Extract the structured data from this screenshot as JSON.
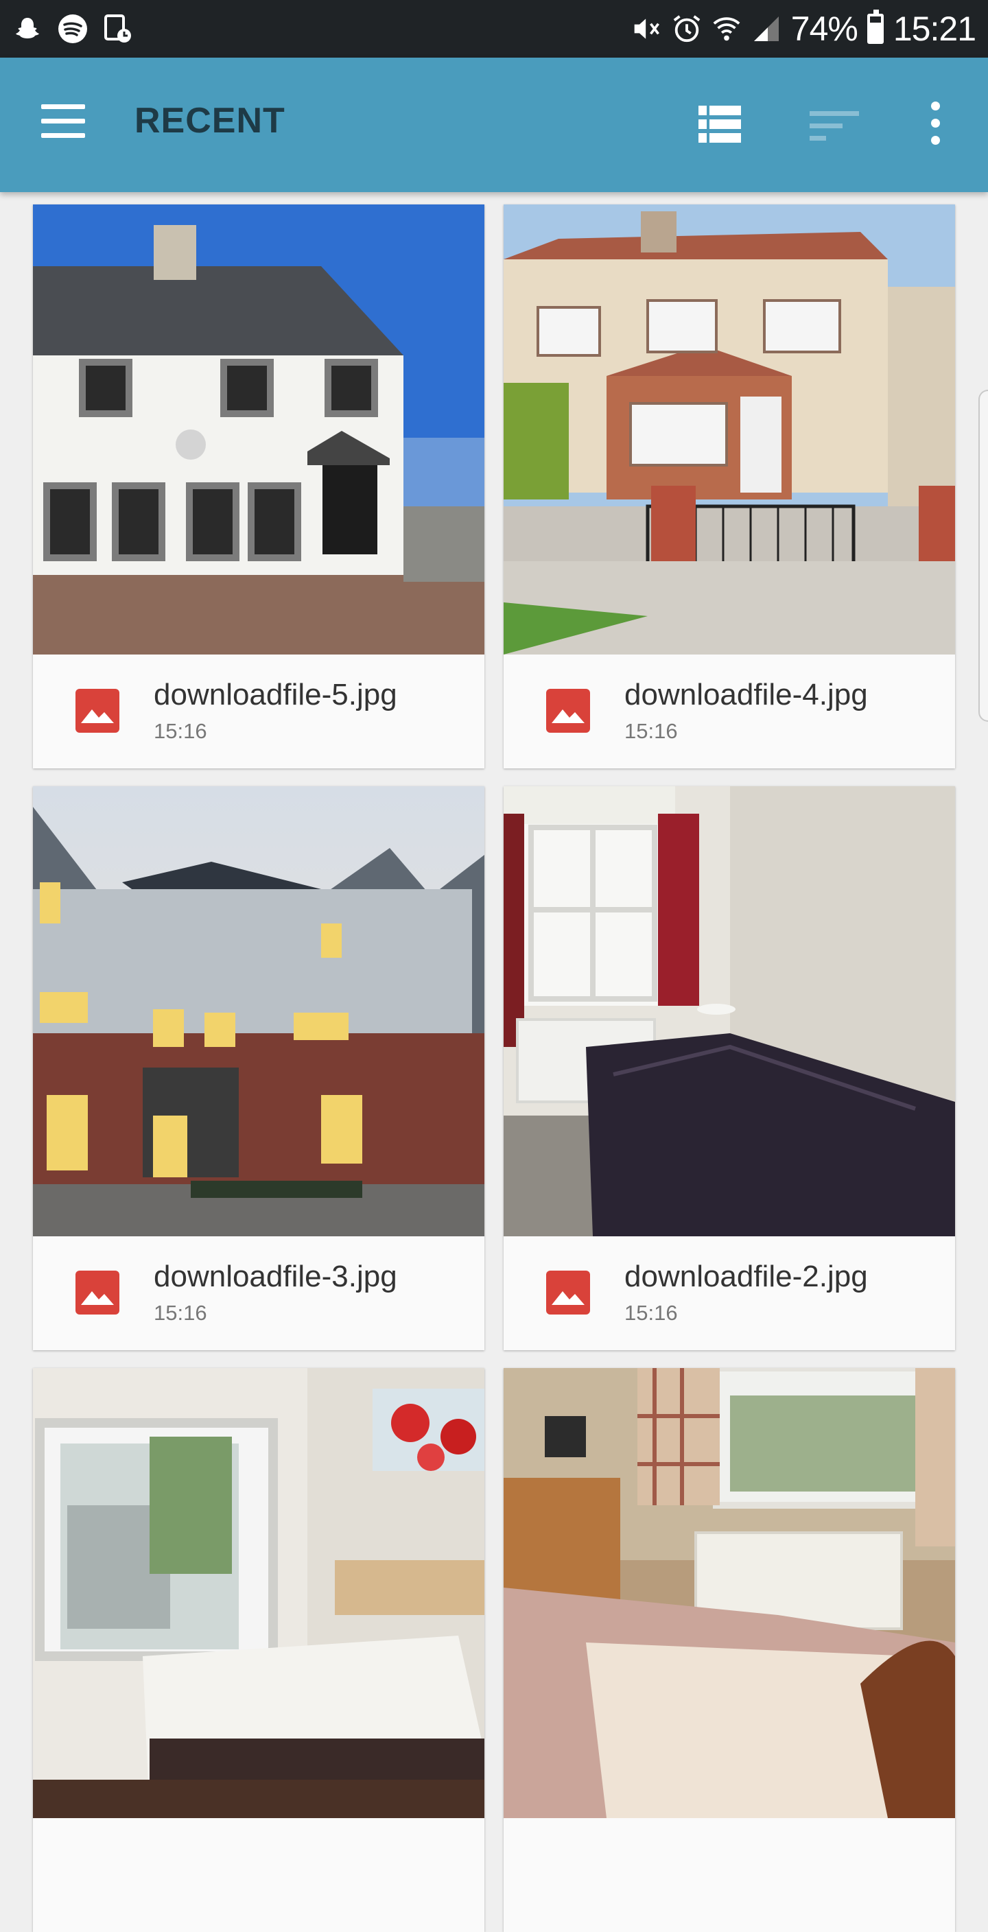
{
  "status_bar": {
    "left_icons": [
      "snapchat-icon",
      "spotify-icon",
      "screenshot-icon"
    ],
    "right_icons": [
      "mute-icon",
      "alarm-icon",
      "wifi-icon",
      "signal-icon"
    ],
    "battery": "74%",
    "battery_level": 0.74,
    "time": "15:21"
  },
  "app_bar": {
    "title": "RECENT",
    "menu_icon": "hamburger-menu-icon",
    "view_icon": "list-view-icon",
    "sort_icon": "sort-icon",
    "more_icon": "more-vert-icon",
    "color": "#4a9cbd"
  },
  "files": [
    {
      "name": "downloadfile-5.jpg",
      "time": "15:16",
      "thumbnail": "white-semi-detached-house-photo"
    },
    {
      "name": "downloadfile-4.jpg",
      "time": "15:16",
      "thumbnail": "semi-detached-house-with-gate-photo"
    },
    {
      "name": "downloadfile-3.jpg",
      "time": "15:16",
      "thumbnail": "brick-houses-at-dusk-photo"
    },
    {
      "name": "downloadfile-2.jpg",
      "time": "15:16",
      "thumbnail": "bedroom-with-purple-bedspread-photo"
    },
    {
      "name": "",
      "time": "",
      "thumbnail": "bedroom-with-poppy-painting-photo"
    },
    {
      "name": "",
      "time": "",
      "thumbnail": "bedroom-with-checked-curtains-photo"
    }
  ],
  "file_icon": "image-file-icon",
  "file_icon_color": "#d9423a"
}
